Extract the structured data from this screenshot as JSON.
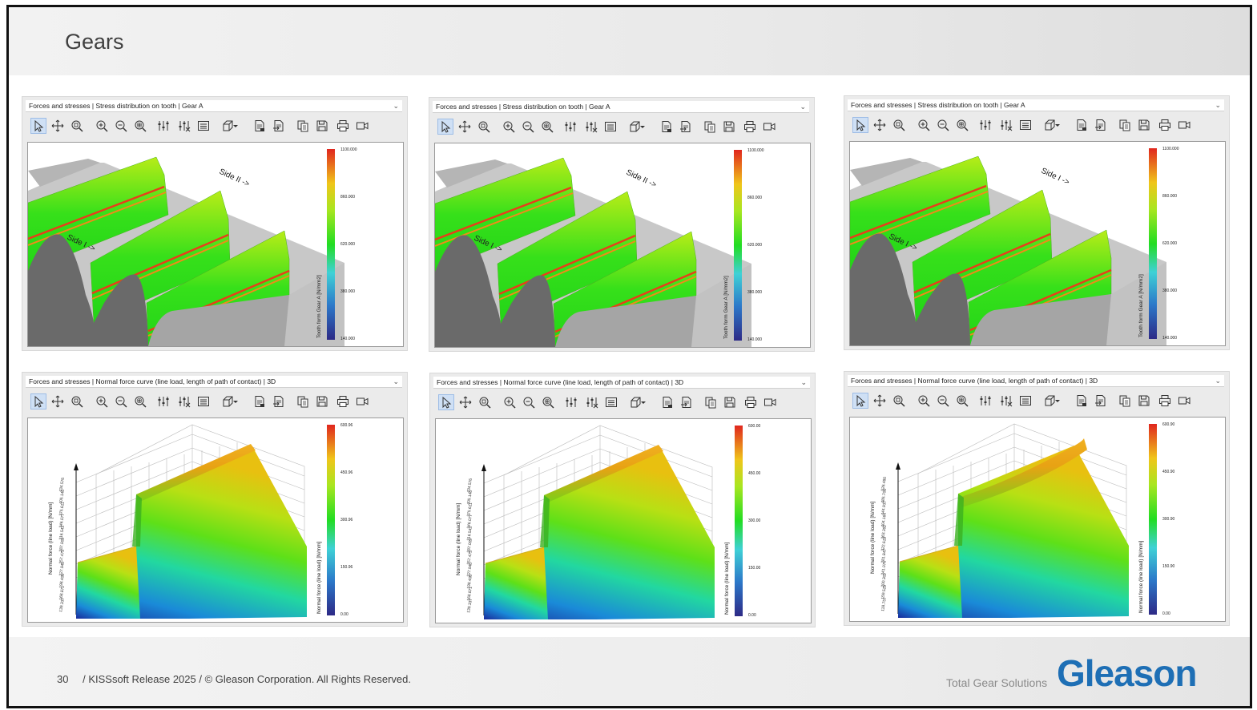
{
  "slide": {
    "title": "Gears",
    "page_number": "30",
    "footer_text": "/ KISSsoft Release 2025 / © Gleason Corporation. All Rights Reserved.",
    "tagline": "Total Gear Solutions",
    "logo_text": "Gleason"
  },
  "toolbar_icons": [
    "select-arrow-icon",
    "move-icon",
    "zoom-window-icon",
    "zoom-in-icon",
    "zoom-out-icon",
    "zoom-fit-icon",
    "sliders-icon",
    "sliders-alt-icon",
    "legend-icon",
    "view-cube-icon",
    "report-icon",
    "export-icon",
    "copy-icon",
    "save-icon",
    "print-icon",
    "video-icon"
  ],
  "panels": [
    {
      "header": "Forces and stresses | Stress distribution on tooth | Gear A",
      "kind": "tooth",
      "side_top": "Side II ->",
      "side_bottom": "Side I ->",
      "colorbar_label": "Tooth form Gear A  [N/mm2]",
      "ticks": [
        "1100.000",
        "860.000",
        "620.000",
        "380.000",
        "140.000"
      ]
    },
    {
      "header": "Forces and stresses | Stress distribution on tooth | Gear A",
      "kind": "tooth",
      "side_top": "Side II ->",
      "side_bottom": "Side I ->",
      "colorbar_label": "Tooth form Gear A  [N/mm2]",
      "ticks": [
        "1100.000",
        "860.000",
        "620.000",
        "380.000",
        "140.000"
      ]
    },
    {
      "header": "Forces and stresses | Stress distribution on tooth | Gear A",
      "kind": "tooth",
      "side_top": "Side I ->",
      "side_bottom": "Side I ->",
      "colorbar_label": "Tooth form Gear A  [N/mm2]",
      "ticks": [
        "1100.000",
        "860.000",
        "620.000",
        "380.000",
        "140.000"
      ]
    },
    {
      "header": "Forces and stresses | Normal force curve (line load, length of path of contact) | 3D",
      "kind": "force",
      "axis_label": "Normal force (line load) [N/mm]",
      "colorbar_label": "Normal force (line load) [N/mm]",
      "ticks": [
        "600.96",
        "450.96",
        "300.96",
        "150.96",
        "0.00"
      ],
      "y_ticks": [
        "434.576",
        "405.146",
        "375.611",
        "346.077",
        "316.543",
        "287.009",
        "257.475",
        "227.940",
        "198.406",
        "168.871",
        "139.337"
      ],
      "peak": false
    },
    {
      "header": "Forces and stresses | Normal force curve (line load, length of path of contact) | 3D",
      "kind": "force",
      "axis_label": "Normal force (line load) [N/mm]",
      "colorbar_label": "Normal force (line load) [N/mm]",
      "ticks": [
        "600.00",
        "450.00",
        "300.00",
        "150.00",
        "0.00"
      ],
      "y_ticks": [
        "434.576",
        "405.146",
        "375.611",
        "346.077",
        "316.543",
        "287.009",
        "257.475",
        "227.940",
        "198.406",
        "168.871",
        "139.337"
      ],
      "peak": false
    },
    {
      "header": "Forces and stresses | Normal force curve (line load, length of path of contact) | 3D",
      "kind": "force",
      "axis_label": "Normal force (line load) [N/mm]",
      "colorbar_label": "Normal force (line load) [N/mm]",
      "ticks": [
        "600.90",
        "450.90",
        "300.90",
        "150.90",
        "0.00"
      ],
      "y_ticks": [
        "526.480",
        "485.706",
        "444.937",
        "404.164",
        "363.392",
        "322.619",
        "281.847",
        "241.074",
        "200.302",
        "159.529",
        "118.757"
      ],
      "peak": true
    }
  ]
}
